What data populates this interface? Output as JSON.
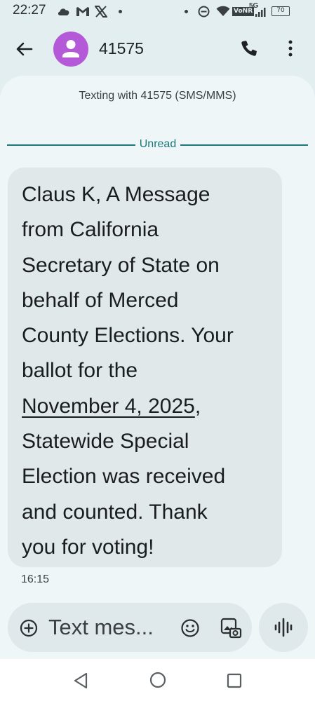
{
  "status_bar": {
    "time": "22:27",
    "icons": [
      "cloud-icon",
      "gmail-icon",
      "x-icon",
      "dot-icon",
      "dot-icon",
      "dnd-icon",
      "wifi-icon",
      "volte-icon",
      "signal-icon",
      "battery-icon"
    ],
    "network_badge": "VoNR",
    "network_type": "5G",
    "battery_level": "70"
  },
  "app_bar": {
    "contact_name": "41575",
    "avatar_color": "#b45ad8"
  },
  "conversation": {
    "texting_with": "Texting with 41575 (SMS/MMS)",
    "unread_label": "Unread",
    "message": {
      "line1": "Claus K, A Message",
      "line2": "from California",
      "line3": "Secretary of State on",
      "line4": "behalf of Merced",
      "line5": "County Elections. Your",
      "line6": "ballot for the",
      "date_link": "November 4, 2025",
      "line7_suffix": ",",
      "line8": "Statewide Special",
      "line9": "Election was received",
      "line10": "and counted. Thank",
      "line11": "you for voting!"
    },
    "timestamp": "16:15"
  },
  "compose": {
    "placeholder": "Text mes..."
  },
  "colors": {
    "accent_teal": "#1c7777",
    "background": "#e3eef0",
    "bubble": "#e0e8ea"
  }
}
